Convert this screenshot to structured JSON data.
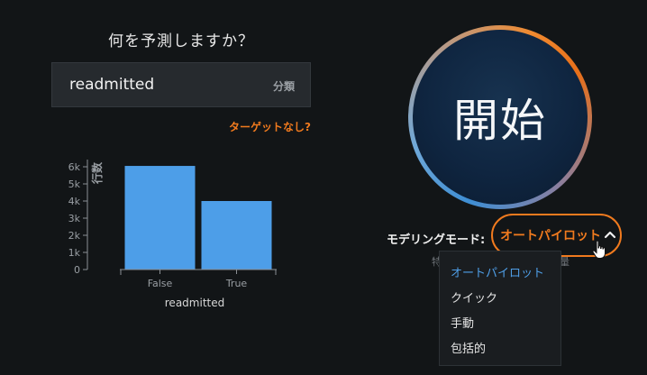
{
  "prediction": {
    "question": "何を予測しますか？",
    "target_value": "readmitted",
    "target_type": "分類",
    "no_target_link": "ターゲットなし?"
  },
  "chart_data": {
    "type": "bar",
    "categories": [
      "False",
      "True"
    ],
    "values": [
      6050,
      4000
    ],
    "xlabel": "readmitted",
    "ylabel": "行数",
    "ylim": [
      0,
      6000
    ],
    "yticks": [
      "0",
      "1k",
      "2k",
      "3k",
      "4k",
      "5k",
      "6k"
    ],
    "bar_color": "#4d9ee8",
    "grid": false
  },
  "start_button": {
    "label": "開始"
  },
  "modeling_mode": {
    "label": "モデリングモード:",
    "value": "オートパイロット",
    "accent_color": "#f07a1e",
    "obscured_left": "特",
    "obscured_right": "量",
    "options": [
      {
        "label": "オートパイロット",
        "selected": true
      },
      {
        "label": "クイック",
        "selected": false
      },
      {
        "label": "手動",
        "selected": false
      },
      {
        "label": "包括的",
        "selected": false
      }
    ]
  },
  "icons": {
    "dropdown_chevron": "chevron-up-icon",
    "mouse_cursor": "hand-pointer-icon"
  }
}
